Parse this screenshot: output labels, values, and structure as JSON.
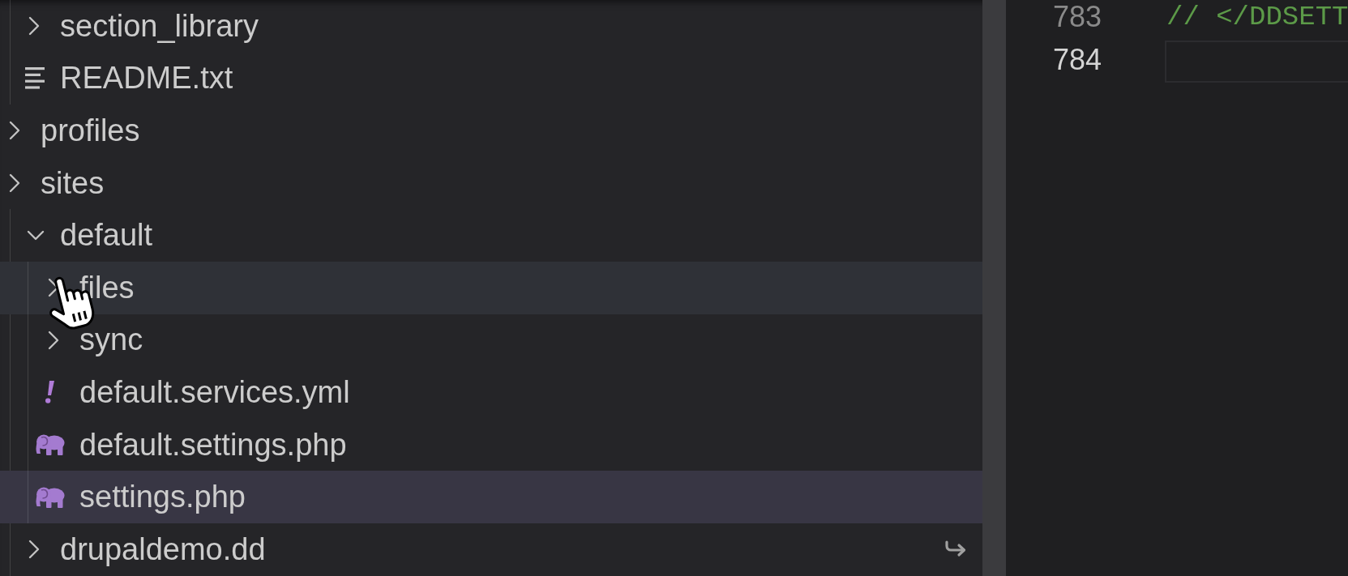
{
  "explorer": {
    "tree": [
      {
        "children": [
          {
            "kind": "folder",
            "label": "section_library",
            "expanded": false,
            "selected": false,
            "hovered": false,
            "symlink": false
          },
          {
            "kind": "text",
            "label": "README.txt",
            "selected": false,
            "hovered": false,
            "symlink": false
          }
        ]
      },
      {
        "kind": "folder",
        "label": "profiles",
        "expanded": false,
        "selected": false,
        "hovered": false,
        "symlink": false
      },
      {
        "kind": "folder",
        "label": "sites",
        "expanded": false,
        "selected": false,
        "hovered": false,
        "symlink": false,
        "children": [
          {
            "kind": "folder",
            "label": "default",
            "expanded": true,
            "selected": false,
            "hovered": false,
            "symlink": false,
            "children": [
              {
                "kind": "folder",
                "label": "files",
                "expanded": false,
                "selected": false,
                "hovered": true,
                "symlink": false
              },
              {
                "kind": "folder",
                "label": "sync",
                "expanded": false,
                "selected": false,
                "hovered": false,
                "symlink": false
              },
              {
                "kind": "yaml",
                "label": "default.services.yml",
                "selected": false,
                "hovered": false,
                "symlink": false
              },
              {
                "kind": "php",
                "label": "default.settings.php",
                "selected": false,
                "hovered": false,
                "symlink": false
              },
              {
                "kind": "php",
                "label": "settings.php",
                "selected": true,
                "hovered": false,
                "symlink": false
              }
            ]
          },
          {
            "kind": "folder",
            "label": "drupaldemo.dd",
            "expanded": false,
            "selected": false,
            "hovered": false,
            "symlink": true
          }
        ]
      }
    ]
  },
  "editor": {
    "lines": [
      {
        "number": "783",
        "code": "// </DDSETT",
        "current": false
      },
      {
        "number": "784",
        "current": true
      }
    ]
  }
}
